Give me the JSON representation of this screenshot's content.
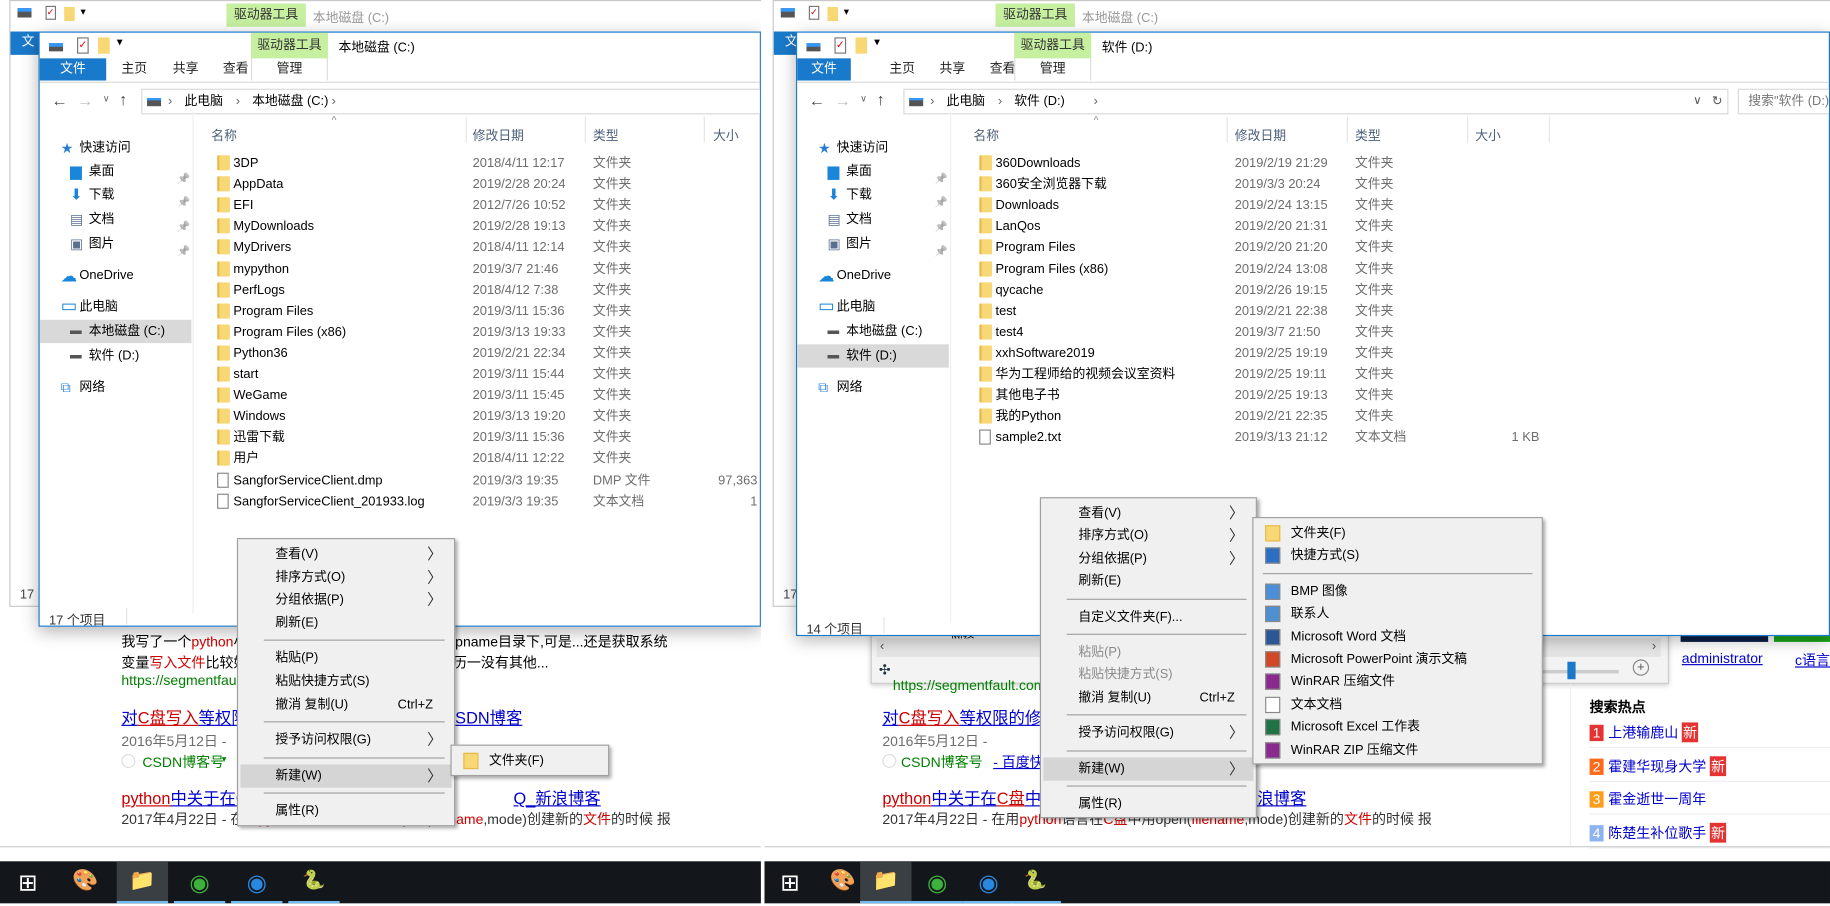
{
  "colors": {
    "accent": "#1979ca",
    "drive_tools_tab": "#c6efa0",
    "menu_bg": "#f0f0f0",
    "taskbar": "#13171b",
    "folder": "#f8d775"
  },
  "left": {
    "background_window": {
      "tool_tab": "驱动器工具",
      "title": "本地磁盘 (C:)",
      "file_tab_partial": "文",
      "status_partial": "17"
    },
    "window": {
      "tool_tab": "驱动器工具",
      "title": "本地磁盘 (C:)",
      "tabs": {
        "file": "文件",
        "home": "主页",
        "share": "共享",
        "view": "查看",
        "manage": "管理"
      },
      "breadcrumb": [
        "此电脑",
        "本地磁盘 (C:)"
      ],
      "columns": {
        "name": "名称",
        "date": "修改日期",
        "type": "类型",
        "size": "大小"
      },
      "nav": [
        {
          "label": "快速访问",
          "icon": "star-icon"
        },
        {
          "label": "桌面",
          "icon": "desktop-icon",
          "pinned": true
        },
        {
          "label": "下载",
          "icon": "download-icon",
          "pinned": true
        },
        {
          "label": "文档",
          "icon": "document-icon",
          "pinned": true
        },
        {
          "label": "图片",
          "icon": "picture-icon",
          "pinned": true
        },
        {
          "label": "OneDrive",
          "icon": "cloud-icon"
        },
        {
          "label": "此电脑",
          "icon": "computer-icon"
        },
        {
          "label": "本地磁盘 (C:)",
          "icon": "drive-icon",
          "indent": true,
          "selected": true
        },
        {
          "label": "软件 (D:)",
          "icon": "drive-icon",
          "indent": true
        },
        {
          "label": "网络",
          "icon": "network-icon"
        }
      ],
      "files": [
        {
          "name": "3DP",
          "date": "2018/4/11 12:17",
          "type": "文件夹",
          "size": "",
          "kind": "folder"
        },
        {
          "name": "AppData",
          "date": "2019/2/28 20:24",
          "type": "文件夹",
          "size": "",
          "kind": "folder"
        },
        {
          "name": "EFI",
          "date": "2012/7/26 10:52",
          "type": "文件夹",
          "size": "",
          "kind": "folder"
        },
        {
          "name": "MyDownloads",
          "date": "2019/2/28 19:13",
          "type": "文件夹",
          "size": "",
          "kind": "folder"
        },
        {
          "name": "MyDrivers",
          "date": "2018/4/11 12:14",
          "type": "文件夹",
          "size": "",
          "kind": "folder"
        },
        {
          "name": "mypython",
          "date": "2019/3/7 21:46",
          "type": "文件夹",
          "size": "",
          "kind": "folder"
        },
        {
          "name": "PerfLogs",
          "date": "2018/4/12 7:38",
          "type": "文件夹",
          "size": "",
          "kind": "folder"
        },
        {
          "name": "Program Files",
          "date": "2019/3/11 15:36",
          "type": "文件夹",
          "size": "",
          "kind": "folder"
        },
        {
          "name": "Program Files (x86)",
          "date": "2019/3/13 19:33",
          "type": "文件夹",
          "size": "",
          "kind": "folder"
        },
        {
          "name": "Python36",
          "date": "2019/2/21 22:34",
          "type": "文件夹",
          "size": "",
          "kind": "folder"
        },
        {
          "name": "start",
          "date": "2019/3/11 15:44",
          "type": "文件夹",
          "size": "",
          "kind": "folder"
        },
        {
          "name": "WeGame",
          "date": "2019/3/11 15:45",
          "type": "文件夹",
          "size": "",
          "kind": "folder"
        },
        {
          "name": "Windows",
          "date": "2019/3/13 19:20",
          "type": "文件夹",
          "size": "",
          "kind": "folder"
        },
        {
          "name": "迅雷下载",
          "date": "2019/3/11 15:36",
          "type": "文件夹",
          "size": "",
          "kind": "folder"
        },
        {
          "name": "用户",
          "date": "2018/4/11 12:22",
          "type": "文件夹",
          "size": "",
          "kind": "folder"
        },
        {
          "name": "SangforServiceClient.dmp",
          "date": "2019/3/3 19:35",
          "type": "DMP 文件",
          "size": "97,363",
          "kind": "file"
        },
        {
          "name": "SangforServiceClient_201933.log",
          "date": "2019/3/3 19:35",
          "type": "文本文档",
          "size": "1",
          "kind": "file"
        }
      ],
      "status": "17 个项目"
    },
    "context_menu": [
      {
        "label": "查看(V)",
        "arrow": true
      },
      {
        "label": "排序方式(O)",
        "arrow": true
      },
      {
        "label": "分组依据(P)",
        "arrow": true
      },
      {
        "label": "刷新(E)"
      },
      {
        "separator": true
      },
      {
        "label": "粘贴(P)"
      },
      {
        "label": "粘贴快捷方式(S)"
      },
      {
        "label": "撤消 复制(U)",
        "shortcut": "Ctrl+Z"
      },
      {
        "separator": true
      },
      {
        "label": "授予访问权限(G)",
        "arrow": true
      },
      {
        "separator": true
      },
      {
        "label": "新建(W)",
        "arrow": true,
        "highlighted": true
      },
      {
        "separator": true
      },
      {
        "label": "属性(R)"
      }
    ],
    "submenu": [
      {
        "label": "文件夹(F)",
        "icon": "folder-icon"
      }
    ],
    "web": {
      "snippet1_a": "我写了一个",
      "snippet1_b": "python",
      "snippet1_c": "小",
      "snippet1_right": "pname目录下,可是...还是获取系统",
      "snippet2_a": "变量",
      "snippet2_b": "写入文件",
      "snippet2_c": "比较好",
      "snippet2_right": "历一没有其他...",
      "url": "https://segmentfault",
      "result2_a": "对",
      "result2_b": "C盘写入",
      "result2_c": "等权限",
      "result2_right": "SDN博客",
      "date2": "2016年5月12日 -",
      "source2": "CSDN博客号",
      "result3_a": "python",
      "result3_b": "中关于在C",
      "result3_right": "Q_新浪博客",
      "line3": [
        "2017年4月22日 - 在用",
        "python",
        "语言在",
        "C盘",
        "中用open(",
        "filename",
        ",mode)创建新的",
        "文件",
        "的时候 报"
      ]
    }
  },
  "right": {
    "background_window": {
      "tool_tab": "驱动器工具",
      "title": "本地磁盘 (C:)",
      "file_tab_partial": "文",
      "status_partial": "17"
    },
    "window": {
      "tool_tab": "驱动器工具",
      "title": "软件 (D:)",
      "tabs": {
        "file": "文件",
        "home": "主页",
        "share": "共享",
        "view": "查看",
        "manage": "管理"
      },
      "breadcrumb": [
        "此电脑",
        "软件 (D:)"
      ],
      "search_placeholder": "搜索\"软件 (D:)\"",
      "columns": {
        "name": "名称",
        "date": "修改日期",
        "type": "类型",
        "size": "大小"
      },
      "nav": [
        {
          "label": "快速访问",
          "icon": "star-icon"
        },
        {
          "label": "桌面",
          "icon": "desktop-icon",
          "pinned": true
        },
        {
          "label": "下载",
          "icon": "download-icon",
          "pinned": true
        },
        {
          "label": "文档",
          "icon": "document-icon",
          "pinned": true
        },
        {
          "label": "图片",
          "icon": "picture-icon",
          "pinned": true
        },
        {
          "label": "OneDrive",
          "icon": "cloud-icon"
        },
        {
          "label": "此电脑",
          "icon": "computer-icon"
        },
        {
          "label": "本地磁盘 (C:)",
          "icon": "drive-icon",
          "indent": true
        },
        {
          "label": "软件 (D:)",
          "icon": "drive-icon",
          "indent": true,
          "selected": true
        },
        {
          "label": "网络",
          "icon": "network-icon"
        }
      ],
      "files": [
        {
          "name": "360Downloads",
          "date": "2019/2/19 21:29",
          "type": "文件夹",
          "size": "",
          "kind": "folder"
        },
        {
          "name": "360安全浏览器下载",
          "date": "2019/3/3 20:24",
          "type": "文件夹",
          "size": "",
          "kind": "folder"
        },
        {
          "name": "Downloads",
          "date": "2019/2/24 13:15",
          "type": "文件夹",
          "size": "",
          "kind": "folder"
        },
        {
          "name": "LanQos",
          "date": "2019/2/20 21:31",
          "type": "文件夹",
          "size": "",
          "kind": "folder"
        },
        {
          "name": "Program Files",
          "date": "2019/2/20 21:20",
          "type": "文件夹",
          "size": "",
          "kind": "folder"
        },
        {
          "name": "Program Files (x86)",
          "date": "2019/2/24 13:08",
          "type": "文件夹",
          "size": "",
          "kind": "folder"
        },
        {
          "name": "qycache",
          "date": "2019/2/26 19:15",
          "type": "文件夹",
          "size": "",
          "kind": "folder"
        },
        {
          "name": "test",
          "date": "2019/2/21 22:38",
          "type": "文件夹",
          "size": "",
          "kind": "folder"
        },
        {
          "name": "test4",
          "date": "2019/3/7 21:50",
          "type": "文件夹",
          "size": "",
          "kind": "folder"
        },
        {
          "name": "xxhSoftware2019",
          "date": "2019/2/25 19:19",
          "type": "文件夹",
          "size": "",
          "kind": "folder"
        },
        {
          "name": "华为工程师给的视频会议室资料",
          "date": "2019/2/25 19:11",
          "type": "文件夹",
          "size": "",
          "kind": "folder"
        },
        {
          "name": "其他电子书",
          "date": "2019/2/25 19:13",
          "type": "文件夹",
          "size": "",
          "kind": "folder"
        },
        {
          "name": "我的Python",
          "date": "2019/2/21 22:35",
          "type": "文件夹",
          "size": "",
          "kind": "folder"
        },
        {
          "name": "sample2.txt",
          "date": "2019/3/13 21:12",
          "type": "文本文档",
          "size": "1 KB",
          "kind": "file"
        }
      ],
      "status": "14 个项目"
    },
    "context_menu": [
      {
        "label": "查看(V)",
        "arrow": true
      },
      {
        "label": "排序方式(O)",
        "arrow": true
      },
      {
        "label": "分组依据(P)",
        "arrow": true
      },
      {
        "label": "刷新(E)"
      },
      {
        "separator": true
      },
      {
        "label": "自定义文件夹(F)..."
      },
      {
        "separator": true
      },
      {
        "label": "粘贴(P)",
        "disabled": true
      },
      {
        "label": "粘贴快捷方式(S)",
        "disabled": true
      },
      {
        "label": "撤消 复制(U)",
        "shortcut": "Ctrl+Z"
      },
      {
        "separator": true
      },
      {
        "label": "授予访问权限(G)",
        "arrow": true
      },
      {
        "separator": true
      },
      {
        "label": "新建(W)",
        "arrow": true,
        "highlighted": true
      },
      {
        "separator": true
      },
      {
        "label": "属性(R)"
      }
    ],
    "submenu": [
      {
        "label": "文件夹(F)",
        "icon": "folder-icon"
      },
      {
        "label": "快捷方式(S)",
        "icon": "shortcut-icon"
      },
      {
        "separator": true
      },
      {
        "label": "BMP 图像",
        "icon": "bmp-image-icon"
      },
      {
        "label": "联系人",
        "icon": "contact-icon"
      },
      {
        "label": "Microsoft Word 文档",
        "icon": "word-icon"
      },
      {
        "label": "Microsoft PowerPoint 演示文稿",
        "icon": "powerpoint-icon"
      },
      {
        "label": "WinRAR 压缩文件",
        "icon": "winrar-icon"
      },
      {
        "label": "文本文档",
        "icon": "text-document-icon"
      },
      {
        "label": "Microsoft Excel 工作表",
        "icon": "excel-icon"
      },
      {
        "label": "WinRAR ZIP 压缩文件",
        "icon": "winrar-zip-icon"
      }
    ],
    "web": {
      "behind_nav": "网络",
      "url": "https://segmentfault.com/q",
      "result2_a": "对",
      "result2_b": "C盘写入",
      "result2_c": "等权限的修",
      "date2": "2016年5月12日 -",
      "source2": "CSDN博客号",
      "source2_extra": "- 百度快",
      "result3_a": "python",
      "result3_b": "中关于在",
      "result3_c": "C盘",
      "result3_d": "中新建",
      "result3_e": "文件",
      "result3_f": "的问题_建会QoQ_新浪博客",
      "line3": [
        "2017年4月22日 - 在用",
        "python",
        "语言在",
        "C盘",
        "中用open(",
        "filename",
        ",mode)创建新的",
        "文件",
        "的时候 报"
      ],
      "user_link": "administrator",
      "c_link": "c语言",
      "hot_title": "搜索热点",
      "hot": [
        {
          "rank": "1",
          "text": "上港输鹿山",
          "badge": "新",
          "color": "#e53333"
        },
        {
          "rank": "2",
          "text": "霍建华现身大学",
          "badge": "新",
          "color": "#ff6a1a"
        },
        {
          "rank": "3",
          "text": "霍金逝世一周年",
          "badge": "",
          "color": "#ff9c1a"
        },
        {
          "rank": "4",
          "text": "陈楚生补位歌手",
          "badge": "新",
          "color": "#8db4f0"
        }
      ]
    }
  },
  "taskbar": {
    "icons": [
      "windows-start-icon",
      "paint-icon",
      "file-explorer-icon",
      "360-browser-icon",
      "blue-app-icon",
      "python-file-icon"
    ]
  }
}
